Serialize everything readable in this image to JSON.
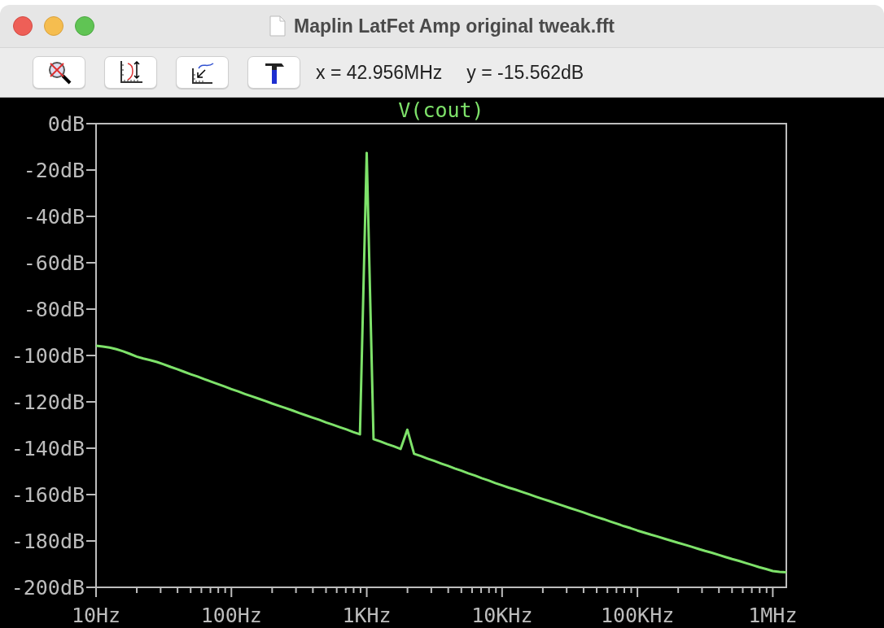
{
  "window": {
    "title": "Maplin LatFet Amp original tweak.fft"
  },
  "toolbar": {
    "cursor_x": "x = 42.956MHz",
    "cursor_y": "y = -15.562dB"
  },
  "plot": {
    "chart_data": {
      "type": "line",
      "ylim": [
        -200,
        0
      ],
      "categories": [
        "10Hz",
        null,
        null,
        null,
        null,
        null,
        null,
        null,
        null,
        null,
        null,
        null,
        null,
        null,
        null,
        null,
        null,
        null,
        null,
        null,
        "100Hz",
        null,
        null,
        null,
        null,
        null,
        null,
        null,
        null,
        null,
        null,
        null,
        null,
        null,
        null,
        null,
        null,
        null,
        null,
        null,
        "1KHz",
        null,
        null,
        null,
        null,
        null,
        null,
        null,
        null,
        null,
        null,
        null,
        null,
        null,
        null,
        null,
        null,
        null,
        null,
        null,
        "10KHz",
        null,
        null,
        null,
        null,
        null,
        null,
        null,
        null,
        null,
        null,
        null,
        null,
        null,
        null,
        null,
        null,
        null,
        null,
        null,
        "100KHz",
        null,
        null,
        null,
        null,
        null,
        null,
        null,
        null,
        null,
        null,
        null,
        null,
        null,
        null,
        null,
        null,
        null,
        null,
        null,
        "1MHz",
        null,
        null
      ],
      "yticks": [
        {
          "value": 0,
          "label": "0dB"
        },
        {
          "value": -20,
          "label": "-20dB"
        },
        {
          "value": -40,
          "label": "-40dB"
        },
        {
          "value": -60,
          "label": "-60dB"
        },
        {
          "value": -80,
          "label": "-80dB"
        },
        {
          "value": -100,
          "label": "-100dB"
        },
        {
          "value": -120,
          "label": "-120dB"
        },
        {
          "value": -140,
          "label": "-140dB"
        },
        {
          "value": -160,
          "label": "-160dB"
        },
        {
          "value": -180,
          "label": "-180dB"
        },
        {
          "value": -200,
          "label": "-200dB"
        }
      ],
      "series": [
        {
          "name": "V(cout)",
          "color": "#7ee26a",
          "values": [
            -95.8,
            -96.1,
            -96.6,
            -97.3,
            -98.2,
            -99.3,
            -100.5,
            -101.3,
            -102.0,
            -102.8,
            -103.8,
            -104.9,
            -105.9,
            -107.0,
            -108.1,
            -109.1,
            -110.2,
            -111.3,
            -112.3,
            -113.4,
            -114.5,
            -115.5,
            -116.6,
            -117.6,
            -118.6,
            -119.6,
            -120.7,
            -121.7,
            -122.7,
            -123.7,
            -124.8,
            -125.8,
            -126.8,
            -127.8,
            -128.9,
            -129.9,
            -130.9,
            -131.9,
            -133.0,
            -134.0,
            -12.6,
            -136.1,
            -137.1,
            -138.2,
            -139.2,
            -140.3,
            -132.0,
            -142.4,
            -143.4,
            -144.5,
            -145.5,
            -146.6,
            -147.6,
            -148.7,
            -149.7,
            -150.8,
            -151.8,
            -152.9,
            -153.9,
            -155.0,
            -156.0,
            -157.0,
            -157.9,
            -158.9,
            -159.9,
            -160.9,
            -161.9,
            -162.8,
            -163.8,
            -164.8,
            -165.8,
            -166.7,
            -167.7,
            -168.7,
            -169.7,
            -170.6,
            -171.6,
            -172.6,
            -173.6,
            -174.5,
            -175.5,
            -176.4,
            -177.3,
            -178.1,
            -179.0,
            -179.9,
            -180.8,
            -181.6,
            -182.5,
            -183.4,
            -184.3,
            -185.1,
            -186.0,
            -186.9,
            -187.8,
            -188.6,
            -189.5,
            -190.4,
            -191.3,
            -192.1,
            -193.0,
            -193.3,
            -193.5
          ]
        }
      ]
    }
  }
}
